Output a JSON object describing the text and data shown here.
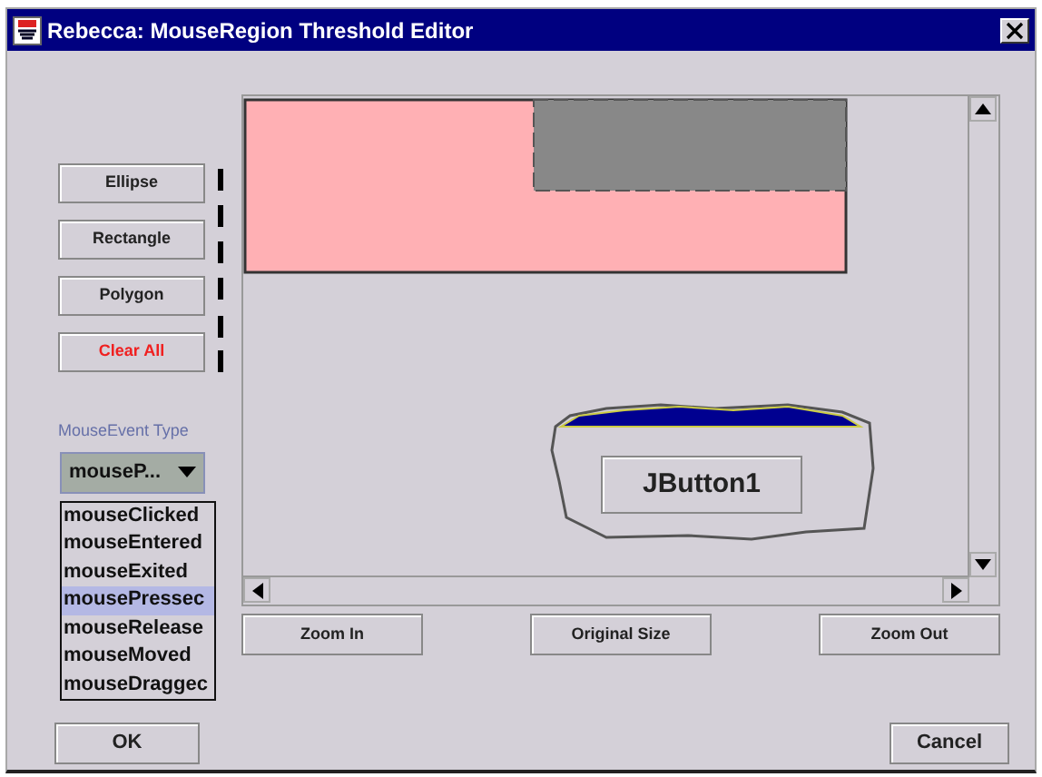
{
  "window": {
    "title": "Rebecca: MouseRegion Threshold Editor"
  },
  "shape_buttons": [
    {
      "label": "Ellipse",
      "kind": "normal"
    },
    {
      "label": "Rectangle",
      "kind": "normal"
    },
    {
      "label": "Polygon",
      "kind": "normal"
    },
    {
      "label": "Clear All",
      "kind": "danger"
    }
  ],
  "event_type": {
    "label": "MouseEvent Type",
    "value": "mouseP...",
    "options": [
      {
        "label": "mouseClicked",
        "selected": false
      },
      {
        "label": "mouseEntered",
        "selected": false
      },
      {
        "label": "mouseExited",
        "selected": false
      },
      {
        "label": "mousePressec",
        "selected": true
      },
      {
        "label": "mouseRelease",
        "selected": false
      },
      {
        "label": "mouseMoved",
        "selected": false
      },
      {
        "label": "mouseDraggec",
        "selected": false
      }
    ]
  },
  "canvas": {
    "region_button": "JButton1"
  },
  "zoom_buttons": [
    "Zoom In",
    "Original Size",
    "Zoom Out"
  ],
  "buttons": [
    "OK",
    "Cancel"
  ]
}
